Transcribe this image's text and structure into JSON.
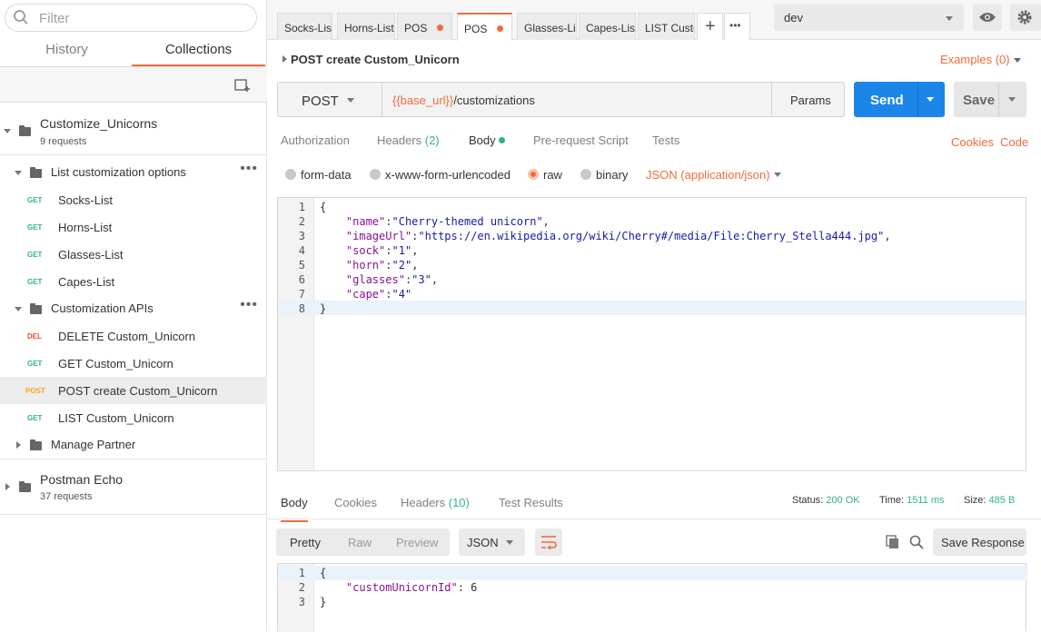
{
  "sidebar": {
    "filter_placeholder": "Filter",
    "tabs": [
      "History",
      "Collections"
    ],
    "collections": [
      {
        "name": "Customize_Unicorns",
        "count": "9 requests"
      },
      {
        "name": "Postman Echo",
        "count": "37 requests"
      }
    ],
    "folders": [
      {
        "name": "List customization options",
        "items": [
          {
            "method": "GET",
            "name": "Socks-List"
          },
          {
            "method": "GET",
            "name": "Horns-List"
          },
          {
            "method": "GET",
            "name": "Glasses-List"
          },
          {
            "method": "GET",
            "name": "Capes-List"
          }
        ]
      },
      {
        "name": "Customization APIs",
        "items": [
          {
            "method": "DEL",
            "name": "DELETE Custom_Unicorn"
          },
          {
            "method": "GET",
            "name": "GET Custom_Unicorn"
          },
          {
            "method": "POST",
            "name": "POST create Custom_Unicorn"
          },
          {
            "method": "GET",
            "name": "LIST Custom_Unicorn"
          }
        ]
      },
      {
        "name": "Manage Partner"
      }
    ],
    "dots": "•••"
  },
  "tabs": [
    "Socks-List",
    "Horns-List",
    "POS",
    "POS",
    "Glasses-Lis",
    "Capes-List",
    "LIST Custo"
  ],
  "tab_plus": "+",
  "tab_more": "•••",
  "environment": "dev",
  "request": {
    "name": "POST create Custom_Unicorn",
    "examples": "Examples (0)",
    "method": "POST",
    "url_var": "{{base_url}}",
    "url_path": "/customizations",
    "params": "Params",
    "send": "Send",
    "save": "Save",
    "tabs": [
      "Authorization",
      "Headers (2)",
      "Body",
      "Pre-request Script",
      "Tests"
    ],
    "links": [
      "Cookies",
      "Code"
    ],
    "body_options": [
      "form-data",
      "x-www-form-urlencoded",
      "raw",
      "binary"
    ],
    "content_type": "JSON (application/json)",
    "body_lines": [
      "{",
      "    \"name\":\"Cherry-themed unicorn\",",
      "    \"imageUrl\":\"https://en.wikipedia.org/wiki/Cherry#/media/File:Cherry_Stella444.jpg\",",
      "    \"sock\":\"1\",",
      "    \"horn\":\"2\",",
      "    \"glasses\":\"3\",",
      "    \"cape\":\"4\"",
      "}"
    ]
  },
  "response": {
    "tabs": [
      "Body",
      "Cookies",
      "Headers (10)",
      "Test Results"
    ],
    "status_label": "Status:",
    "status": "200 OK",
    "time_label": "Time:",
    "time": "1511 ms",
    "size_label": "Size:",
    "size": "485 B",
    "view_modes": [
      "Pretty",
      "Raw",
      "Preview"
    ],
    "format": "JSON",
    "save_response": "Save Response",
    "body_lines": [
      "{",
      "    \"customUnicornId\": 6",
      "}"
    ]
  },
  "colors": {
    "accent": "#f26b3a",
    "send": "#1b86e8",
    "status_ok": "#2eb67d",
    "get": "#2eb67d",
    "post": "#f5a623",
    "del": "#e64c3c"
  }
}
